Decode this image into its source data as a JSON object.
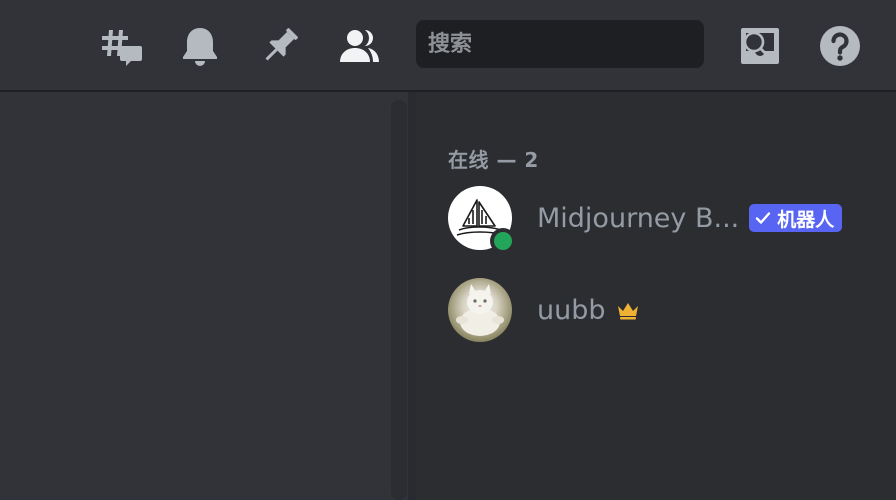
{
  "toolbar": {
    "icons": [
      "threads-icon",
      "bell-icon",
      "pin-icon",
      "members-icon",
      "inbox-icon",
      "help-icon"
    ],
    "search_placeholder": "搜索"
  },
  "members": {
    "section_title": "在线 — 2",
    "list": [
      {
        "name": "Midjourney B...",
        "badge": "机器人",
        "status": "online",
        "status_color": "#23a55a",
        "badge_color": "#5865f2"
      },
      {
        "name": "uubb",
        "owner_crown": "crown-icon",
        "crown_color": "#f0b232"
      }
    ]
  },
  "colors": {
    "icon": "#b5bac1",
    "icon_active": "#f2f3f5"
  }
}
